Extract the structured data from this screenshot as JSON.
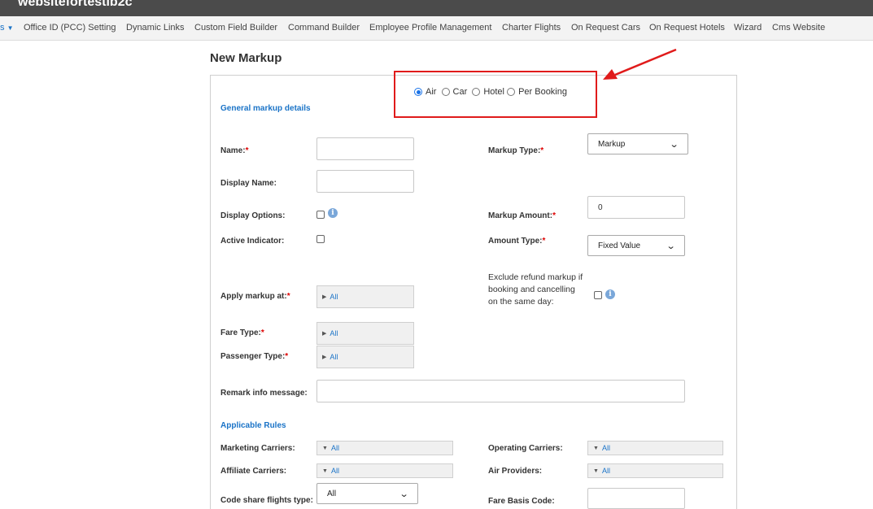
{
  "topbar": {
    "title": "websitefortestib2c"
  },
  "nav": {
    "partial_item": "s",
    "items": [
      "Office ID (PCC) Setting",
      "Dynamic Links",
      "Custom Field Builder",
      "Command Builder",
      "Employee Profile Management",
      "Charter Flights",
      "On Request Cars",
      "On Request Hotels",
      "Wizard",
      "Cms Website"
    ]
  },
  "page": {
    "title": "New Markup"
  },
  "product_types": {
    "options": [
      "Air",
      "Car",
      "Hotel",
      "Per Booking"
    ],
    "selected": "Air"
  },
  "sections": {
    "general": "General markup details",
    "rules": "Applicable Rules"
  },
  "form": {
    "name_label": "Name:",
    "display_name_label": "Display Name:",
    "display_options_label": "Display Options:",
    "active_indicator_label": "Active Indicator:",
    "apply_markup_label": "Apply markup at:",
    "apply_markup_value": "All",
    "fare_type_label": "Fare Type:",
    "fare_type_value": "All",
    "passenger_type_label": "Passenger Type:",
    "passenger_type_value": "All",
    "remark_label": "Remark info message:",
    "markup_type_label": "Markup Type:",
    "markup_type_value": "Markup",
    "markup_amount_label": "Markup Amount:",
    "markup_amount_value": "0",
    "amount_type_label": "Amount Type:",
    "amount_type_value": "Fixed Value",
    "exclude_refund_label": "Exclude refund markup if booking and cancelling on the same day:",
    "required_mark": "*"
  },
  "rules": {
    "marketing_carriers_label": "Marketing Carriers:",
    "marketing_carriers_value": "All",
    "affiliate_carriers_label": "Affiliate Carriers:",
    "affiliate_carriers_value": "All",
    "code_share_label": "Code share flights type:",
    "code_share_value": "All",
    "operating_carriers_label": "Operating Carriers:",
    "operating_carriers_value": "All",
    "air_providers_label": "Air Providers:",
    "air_providers_value": "All",
    "fare_basis_label": "Fare Basis Code:"
  },
  "colors": {
    "accent": "#1a73c7",
    "highlight": "#e01b1b",
    "topbar": "#4b4b4b"
  },
  "icons": [
    "chevron-down-icon",
    "info-icon",
    "caret-right-icon",
    "caret-down-icon",
    "red-arrow-annotation"
  ]
}
